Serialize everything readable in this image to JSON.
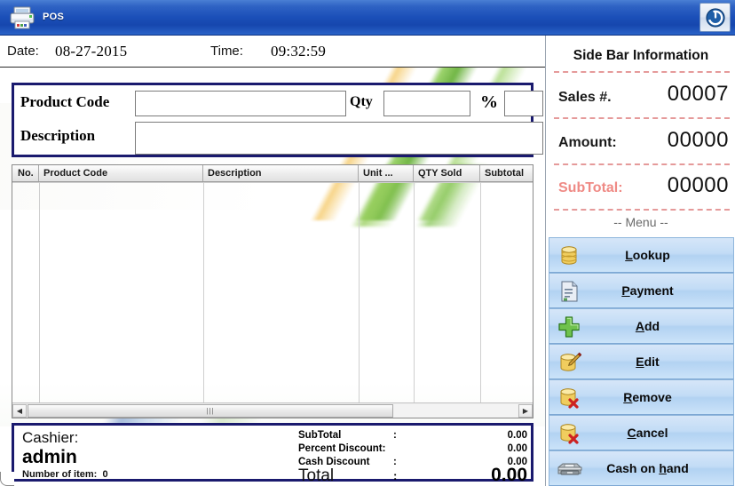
{
  "window": {
    "title": "POS",
    "app_icon": "printer-icon",
    "power_button_icon": "power-icon",
    "titlebar_color": "#1b4fb8"
  },
  "header": {
    "date_label": "Date:",
    "date_value": "08-27-2015",
    "time_label": "Time:",
    "time_value": "09:32:59"
  },
  "entry_form": {
    "product_code_label": "Product Code",
    "product_code_value": "",
    "product_code_placeholder": "",
    "qty_label": "Qty",
    "qty_value": "",
    "percent_label": "%",
    "percent_value": "",
    "description_label": "Description",
    "description_value": "",
    "border_color": "#1a1a6e"
  },
  "grid": {
    "columns": [
      {
        "key": "no",
        "label": "No."
      },
      {
        "key": "product_code",
        "label": "Product Code"
      },
      {
        "key": "description",
        "label": "Description"
      },
      {
        "key": "unit",
        "label": "Unit ..."
      },
      {
        "key": "qty_sold",
        "label": "QTY Sold"
      },
      {
        "key": "subtotal",
        "label": "Subtotal"
      }
    ],
    "rows": [],
    "scrollbar": {
      "left_arrow": "◀",
      "right_arrow": "▶",
      "grip": "|||"
    }
  },
  "summary": {
    "cashier_label": "Cashier:",
    "cashier_name": "admin",
    "number_of_item_label": "Number of item:",
    "number_of_item_value": "0",
    "lines": [
      {
        "label": "SubTotal",
        "colon": ":",
        "value": "0.00"
      },
      {
        "label": "Percent Discount:",
        "colon": "",
        "value": "0.00"
      },
      {
        "label": "Cash Discount",
        "colon": ":",
        "value": "0.00"
      }
    ],
    "total_label": "Total",
    "total_colon": ":",
    "total_value": "0.00",
    "total_underline_color": "#6a1515"
  },
  "sidebar": {
    "title": "Side Bar Information",
    "rows": [
      {
        "label": "Sales #.",
        "value": "00007",
        "color": "#1a1a1a"
      },
      {
        "label": "Amount:",
        "value": "00000",
        "color": "#1a1a1a"
      },
      {
        "label": "SubTotal:",
        "value": "00000",
        "color": "#ef8a85"
      }
    ],
    "menu_caption": "-- Menu --",
    "menu": [
      {
        "label": "Lookup",
        "accel": "L",
        "icon": "database-icon"
      },
      {
        "label": "Payment",
        "accel": "P",
        "icon": "document-icon"
      },
      {
        "label": "Add",
        "accel": "A",
        "icon": "plus-icon"
      },
      {
        "label": "Edit",
        "accel": "E",
        "icon": "edit-pencil-icon"
      },
      {
        "label": "Remove",
        "accel": "R",
        "icon": "database-delete-icon"
      },
      {
        "label": "Cancel",
        "accel": "C",
        "icon": "database-delete-icon"
      },
      {
        "label": "Cash on hand",
        "accel": "h",
        "icon": "cash-drawer-icon"
      }
    ],
    "accent_color": "#b2d2f2",
    "separator_color": "#e59a9a"
  }
}
